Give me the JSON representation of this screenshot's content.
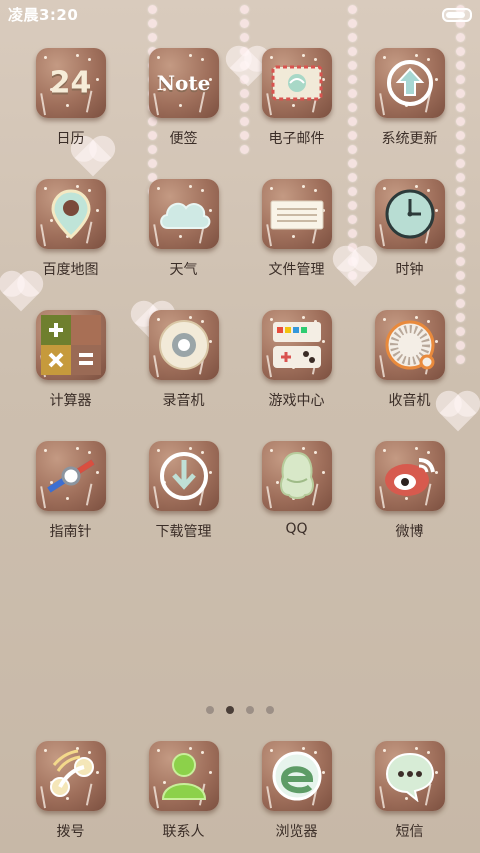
{
  "status": {
    "time": "凌晨3:20",
    "battery_level": 0.85
  },
  "apps": [
    {
      "label": "日历",
      "icon": "calendar-icon",
      "badge_text": "24"
    },
    {
      "label": "便签",
      "icon": "note-icon",
      "badge_text": "Note"
    },
    {
      "label": "电子邮件",
      "icon": "email-icon"
    },
    {
      "label": "系统更新",
      "icon": "update-arrow-icon"
    },
    {
      "label": "百度地图",
      "icon": "map-pin-icon"
    },
    {
      "label": "天气",
      "icon": "cloud-icon"
    },
    {
      "label": "文件管理",
      "icon": "folder-icon"
    },
    {
      "label": "时钟",
      "icon": "clock-icon"
    },
    {
      "label": "计算器",
      "icon": "calculator-icon"
    },
    {
      "label": "录音机",
      "icon": "recorder-icon"
    },
    {
      "label": "游戏中心",
      "icon": "gamepad-icon"
    },
    {
      "label": "收音机",
      "icon": "radio-icon"
    },
    {
      "label": "指南针",
      "icon": "compass-icon"
    },
    {
      "label": "下载管理",
      "icon": "download-icon"
    },
    {
      "label": "QQ",
      "icon": "qq-penguin-icon"
    },
    {
      "label": "微博",
      "icon": "weibo-icon"
    }
  ],
  "page_indicator": {
    "count": 4,
    "active": 2
  },
  "dock": [
    {
      "label": "拨号",
      "icon": "phone-icon"
    },
    {
      "label": "联系人",
      "icon": "contacts-icon"
    },
    {
      "label": "浏览器",
      "icon": "browser-icon"
    },
    {
      "label": "短信",
      "icon": "message-icon"
    }
  ]
}
